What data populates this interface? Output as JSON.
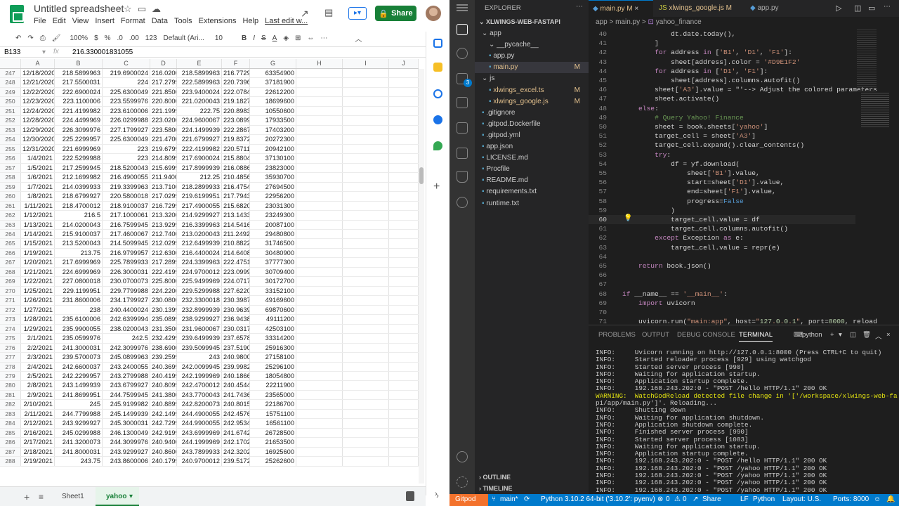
{
  "sheets": {
    "title": "Untitled spreadsheet",
    "menu": [
      "File",
      "Edit",
      "View",
      "Insert",
      "Format",
      "Data",
      "Tools",
      "Extensions",
      "Help"
    ],
    "last_edit": "Last edit w...",
    "share_label": "Share",
    "toolbar": {
      "zoom": "100%",
      "currency": "$",
      "percent": "%",
      "dec_dec": ".0",
      "dec_inc": ".00",
      "format": "123",
      "font": "Default (Ari...",
      "size": "10",
      "bold": "B",
      "italic": "I",
      "strike": "S",
      "color": "A"
    },
    "cell_ref": "B133",
    "formula": "216.330001831055",
    "columns": [
      "A",
      "B",
      "C",
      "D",
      "E",
      "F",
      "G",
      "H",
      "I",
      "J"
    ],
    "rows": [
      [
        "247",
        "12/18/2020",
        "218.5899963",
        "219.6900024",
        "216.0200",
        "218.5899963",
        "216.7729",
        "63354900"
      ],
      [
        "248",
        "12/21/2020",
        "217.5500031",
        "224",
        "217.2799",
        "222.5899963",
        "220.7396",
        "37181900"
      ],
      [
        "249",
        "12/22/2020",
        "222.6900024",
        "225.6300049",
        "221.8500",
        "223.9400024",
        "222.0784",
        "22612200"
      ],
      [
        "250",
        "12/23/2020",
        "223.1100006",
        "223.5599976",
        "220.8000",
        "221.0200043",
        "219.1827",
        "18699600"
      ],
      [
        "251",
        "12/24/2020",
        "221.4199982",
        "223.6100006",
        "221.1999",
        "222.75",
        "220.8983",
        "10550600"
      ],
      [
        "252",
        "12/28/2020",
        "224.4499969",
        "226.0299988",
        "223.0200",
        "224.9600067",
        "223.0899",
        "17933500"
      ],
      [
        "253",
        "12/29/2020",
        "226.3099976",
        "227.1799927",
        "223.5800",
        "224.1499939",
        "222.2867",
        "17403200"
      ],
      [
        "254",
        "12/30/2020",
        "225.2299957",
        "225.6300049",
        "221.4700",
        "221.6799927",
        "219.8372",
        "20272300"
      ],
      [
        "255",
        "12/31/2020",
        "221.6999969",
        "223",
        "219.6799",
        "222.4199982",
        "220.5711",
        "20942100"
      ],
      [
        "256",
        "1/4/2021",
        "222.5299988",
        "223",
        "214.8099",
        "217.6900024",
        "215.8804",
        "37130100"
      ],
      [
        "257",
        "1/5/2021",
        "217.2599945",
        "218.5200043",
        "215.6999",
        "217.8999939",
        "216.0886",
        "23823000"
      ],
      [
        "258",
        "1/6/2021",
        "212.1699982",
        "216.4900055",
        "211.9400",
        "212.25",
        "210.4856",
        "35930700"
      ],
      [
        "259",
        "1/7/2021",
        "214.0399933",
        "219.3399963",
        "213.7100",
        "218.2899933",
        "216.4754",
        "27694500"
      ],
      [
        "260",
        "1/8/2021",
        "218.6799927",
        "220.5800018",
        "217.0299",
        "219.6199951",
        "217.7943",
        "22956200"
      ],
      [
        "261",
        "1/11/2021",
        "218.4700012",
        "218.9100037",
        "216.7299",
        "217.4900055",
        "215.6820",
        "23031300"
      ],
      [
        "262",
        "1/12/2021",
        "216.5",
        "217.1000061",
        "213.3200",
        "214.9299927",
        "213.1433",
        "23249300"
      ],
      [
        "263",
        "1/13/2021",
        "214.0200043",
        "216.7599945",
        "213.9299",
        "216.3399963",
        "214.5416",
        "20087100"
      ],
      [
        "264",
        "1/14/2021",
        "215.9100037",
        "217.4600067",
        "212.7400",
        "213.0200043",
        "211.2492",
        "29480800"
      ],
      [
        "265",
        "1/15/2021",
        "213.5200043",
        "214.5099945",
        "212.0299",
        "212.6499939",
        "210.8822",
        "31746500"
      ],
      [
        "266",
        "1/19/2021",
        "213.75",
        "216.9799957",
        "212.6300",
        "216.4400024",
        "214.6408",
        "30480900"
      ],
      [
        "267",
        "1/20/2021",
        "217.6999969",
        "225.7899933",
        "217.2899",
        "224.3399963",
        "222.4751",
        "37777300"
      ],
      [
        "268",
        "1/21/2021",
        "224.6999969",
        "226.3000031",
        "222.4199",
        "224.9700012",
        "223.0999",
        "30709400"
      ],
      [
        "269",
        "1/22/2021",
        "227.0800018",
        "230.0700073",
        "225.8000",
        "225.9499969",
        "224.0717",
        "30172700"
      ],
      [
        "270",
        "1/25/2021",
        "229.1199951",
        "229.7799988",
        "224.2200",
        "229.5299988",
        "227.6220",
        "33152100"
      ],
      [
        "271",
        "1/26/2021",
        "231.8600006",
        "234.1799927",
        "230.0800",
        "232.3300018",
        "230.3987",
        "49169600"
      ],
      [
        "272",
        "1/27/2021",
        "238",
        "240.4400024",
        "230.1399",
        "232.8999939",
        "230.9639",
        "69870600"
      ],
      [
        "273",
        "1/28/2021",
        "235.6100006",
        "242.6399994",
        "235.0899",
        "238.9299927",
        "236.9438",
        "49111200"
      ],
      [
        "274",
        "1/29/2021",
        "235.9900055",
        "238.0200043",
        "231.3500",
        "231.9600067",
        "230.0317",
        "42503100"
      ],
      [
        "275",
        "2/1/2021",
        "235.0599976",
        "242.5",
        "232.4299",
        "239.6499939",
        "237.6578",
        "33314200"
      ],
      [
        "276",
        "2/2/2021",
        "241.3000031",
        "242.3099976",
        "238.6900",
        "239.5099945",
        "237.5190",
        "25916300"
      ],
      [
        "277",
        "2/3/2021",
        "239.5700073",
        "245.0899963",
        "239.2599",
        "243",
        "240.9800",
        "27158100"
      ],
      [
        "278",
        "2/4/2021",
        "242.6600037",
        "243.2400055",
        "240.3699",
        "242.0099945",
        "239.9982",
        "25296100"
      ],
      [
        "279",
        "2/5/2021",
        "242.2299957",
        "243.2799988",
        "240.4199",
        "242.1999969",
        "240.1866",
        "18054800"
      ],
      [
        "280",
        "2/8/2021",
        "243.1499939",
        "243.6799927",
        "240.8099",
        "242.4700012",
        "240.4544",
        "22211900"
      ],
      [
        "281",
        "2/9/2021",
        "241.8699951",
        "244.7599945",
        "241.3800",
        "243.7700043",
        "241.7436",
        "23565000"
      ],
      [
        "282",
        "2/10/2021",
        "245",
        "245.9199982",
        "240.8899",
        "242.8200073",
        "240.8015",
        "22186700"
      ],
      [
        "283",
        "2/11/2021",
        "244.7799988",
        "245.1499939",
        "242.1499",
        "244.4900055",
        "242.4576",
        "15751100"
      ],
      [
        "284",
        "2/12/2021",
        "243.9299927",
        "245.3000031",
        "242.7299",
        "244.9900055",
        "242.9534",
        "16561100"
      ],
      [
        "285",
        "2/16/2021",
        "245.0299988",
        "246.1300049",
        "242.9199",
        "243.6999969",
        "241.6742",
        "26728500"
      ],
      [
        "286",
        "2/17/2021",
        "241.3200073",
        "244.3099976",
        "240.9400",
        "244.1999969",
        "242.1702",
        "21653500"
      ],
      [
        "287",
        "2/18/2021",
        "241.8000031",
        "243.9299927",
        "240.8600",
        "243.7899933",
        "242.3202",
        "16925600"
      ],
      [
        "288",
        "2/19/2021",
        "243.75",
        "243.8600006",
        "240.1799",
        "240.9700012",
        "239.5172",
        "25262600"
      ]
    ],
    "tabs": [
      "Sheet1",
      "yahoo"
    ]
  },
  "vscode": {
    "explorer_title": "EXPLORER",
    "project": "XLWINGS-WEB-FASTAPI",
    "files": [
      {
        "name": "app",
        "indent": 1,
        "folder": true,
        "m": ""
      },
      {
        "name": "__pycache__",
        "indent": 2,
        "folder": true,
        "m": ""
      },
      {
        "name": "app.py",
        "indent": 2,
        "folder": false,
        "m": ""
      },
      {
        "name": "main.py",
        "indent": 2,
        "folder": false,
        "m": "M"
      },
      {
        "name": "js",
        "indent": 1,
        "folder": true,
        "m": ""
      },
      {
        "name": "xlwings_excel.ts",
        "indent": 2,
        "folder": false,
        "m": "M"
      },
      {
        "name": "xlwings_google.js",
        "indent": 2,
        "folder": false,
        "m": "M"
      },
      {
        "name": ".gitignore",
        "indent": 1,
        "folder": false,
        "m": ""
      },
      {
        "name": ".gitpod.Dockerfile",
        "indent": 1,
        "folder": false,
        "m": ""
      },
      {
        "name": ".gitpod.yml",
        "indent": 1,
        "folder": false,
        "m": ""
      },
      {
        "name": "app.json",
        "indent": 1,
        "folder": false,
        "m": ""
      },
      {
        "name": "LICENSE.md",
        "indent": 1,
        "folder": false,
        "m": ""
      },
      {
        "name": "Procfile",
        "indent": 1,
        "folder": false,
        "m": ""
      },
      {
        "name": "README.md",
        "indent": 1,
        "folder": false,
        "m": ""
      },
      {
        "name": "requirements.txt",
        "indent": 1,
        "folder": false,
        "m": ""
      },
      {
        "name": "runtime.txt",
        "indent": 1,
        "folder": false,
        "m": ""
      }
    ],
    "outline": "OUTLINE",
    "timeline": "TIMELINE",
    "tabs": [
      {
        "name": "main.py",
        "m": "M"
      },
      {
        "name": "xlwings_google.js",
        "m": "M"
      },
      {
        "name": "app.py",
        "m": ""
      }
    ],
    "breadcrumb": [
      "app",
      ">",
      "main.py",
      ">",
      "yahoo_finance"
    ],
    "code": [
      [
        "40",
        "            dt.date.today(),"
      ],
      [
        "41",
        "        ]"
      ],
      [
        "42",
        "        for address in ['B1', 'D1', 'F1']:"
      ],
      [
        "43",
        "            sheet[address].color = '#D9E1F2'"
      ],
      [
        "44",
        "        for address in ['D1', 'F1']:"
      ],
      [
        "45",
        "            sheet[address].columns.autofit()"
      ],
      [
        "46",
        "        sheet['A3'].value = \"'--> Adjust the colored parameters"
      ],
      [
        "47",
        "        sheet.activate()"
      ],
      [
        "48",
        "    else:"
      ],
      [
        "49",
        "        # Query Yahoo! Finance"
      ],
      [
        "50",
        "        sheet = book.sheets['yahoo']"
      ],
      [
        "51",
        "        target_cell = sheet['A3']"
      ],
      [
        "52",
        "        target_cell.expand().clear_contents()"
      ],
      [
        "53",
        "        try:"
      ],
      [
        "54",
        "            df = yf.download("
      ],
      [
        "55",
        "                sheet['B1'].value,"
      ],
      [
        "56",
        "                start=sheet['D1'].value,"
      ],
      [
        "57",
        "                end=sheet['F1'].value,"
      ],
      [
        "58",
        "                progress=False"
      ],
      [
        "59",
        "            )"
      ],
      [
        "60",
        "            target_cell.value = df"
      ],
      [
        "61",
        "            target_cell.columns.autofit()"
      ],
      [
        "62",
        "        except Exception as e:"
      ],
      [
        "63",
        "            target_cell.value = repr(e)"
      ],
      [
        "64",
        ""
      ],
      [
        "65",
        "    return book.json()"
      ],
      [
        "66",
        ""
      ],
      [
        "67",
        ""
      ],
      [
        "68",
        "if __name__ == '__main__':"
      ],
      [
        "69",
        "    import uvicorn"
      ],
      [
        "70",
        ""
      ],
      [
        "71",
        "    uvicorn.run(\"main:app\", host=\"127.0.0.1\", port=8000, reload"
      ]
    ],
    "panel_tabs": [
      "PROBLEMS",
      "OUTPUT",
      "DEBUG CONSOLE",
      "TERMINAL"
    ],
    "terminal_name": "python",
    "terminal": [
      "INFO:     Uvicorn running on http://127.0.0.1:8000 (Press CTRL+C to quit)",
      "INFO:     Started reloader process [929] using watchgod",
      "INFO:     Started server process [990]",
      "INFO:     Waiting for application startup.",
      "INFO:     Application startup complete.",
      "INFO:     192.168.243.202:0 - \"POST /hello HTTP/1.1\" 200 OK",
      "WARNING:  WatchGodReload detected file change in '['/workspace/xlwings-web-fasta",
      "pi/app/main.py']'. Reloading...",
      "INFO:     Shutting down",
      "INFO:     Waiting for application shutdown.",
      "INFO:     Application shutdown complete.",
      "INFO:     Finished server process [990]",
      "INFO:     Started server process [1083]",
      "INFO:     Waiting for application startup.",
      "INFO:     Application startup complete.",
      "INFO:     192.168.243.202:0 - \"POST /hello HTTP/1.1\" 200 OK",
      "INFO:     192.168.243.202:0 - \"POST /yahoo HTTP/1.1\" 200 OK",
      "INFO:     192.168.243.202:0 - \"POST /yahoo HTTP/1.1\" 200 OK",
      "INFO:     192.168.243.202:0 - \"POST /yahoo HTTP/1.1\" 200 OK",
      "INFO:     192.168.243.202:0 - \"POST /yahoo HTTP/1.1\" 200 OK"
    ],
    "status": {
      "gitpod": "Gitpod",
      "branch": "main*",
      "python": "Python 3.10.2 64-bit ('3.10.2': pyenv)",
      "problems": "0",
      "warnings": "0",
      "share": "Share",
      "eol": "LF",
      "lang": "Python",
      "layout": "Layout: U.S.",
      "ports": "Ports: 8000"
    }
  }
}
